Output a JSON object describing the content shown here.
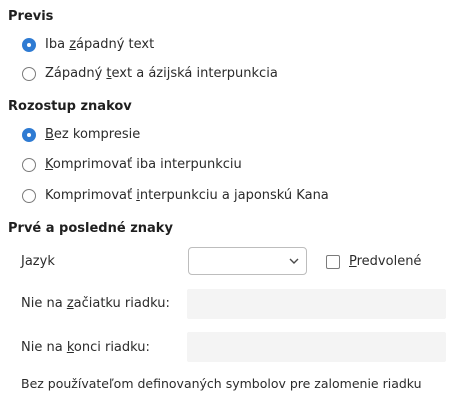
{
  "preview": {
    "title": "Previs",
    "options": [
      {
        "pre": "Iba ",
        "mnemonic": "z",
        "post": "ápadný text",
        "checked": true
      },
      {
        "pre": "Západný ",
        "mnemonic": "t",
        "post": "ext a ázijská interpunkcia",
        "checked": false
      }
    ]
  },
  "spacing": {
    "title": "Rozostup znakov",
    "options": [
      {
        "pre": "",
        "mnemonic": "B",
        "post": "ez kompresie",
        "checked": true
      },
      {
        "pre": "",
        "mnemonic": "K",
        "post": "omprimovať iba interpunkciu",
        "checked": false
      },
      {
        "pre": "Komprimovať ",
        "mnemonic": "i",
        "post": "nterpunkciu a japonskú Kana",
        "checked": false
      }
    ]
  },
  "first_last": {
    "title": "Prvé a posledné znaky",
    "language_label": "Jazyk",
    "language_value": "",
    "default_pre": "",
    "default_mnemonic": "P",
    "default_post": "redvolené",
    "default_checked": false,
    "not_start_pre": "Nie na ",
    "not_start_mnemonic": "z",
    "not_start_post": "ačiatku riadku:",
    "not_start_value": "",
    "not_end_pre": "Nie na ",
    "not_end_mnemonic": "k",
    "not_end_post": "onci riadku:",
    "not_end_value": "",
    "note": "Bez používateľom definovaných symbolov pre zalomenie riadku"
  },
  "icons": {
    "dropdown": "chevron-down-icon"
  }
}
